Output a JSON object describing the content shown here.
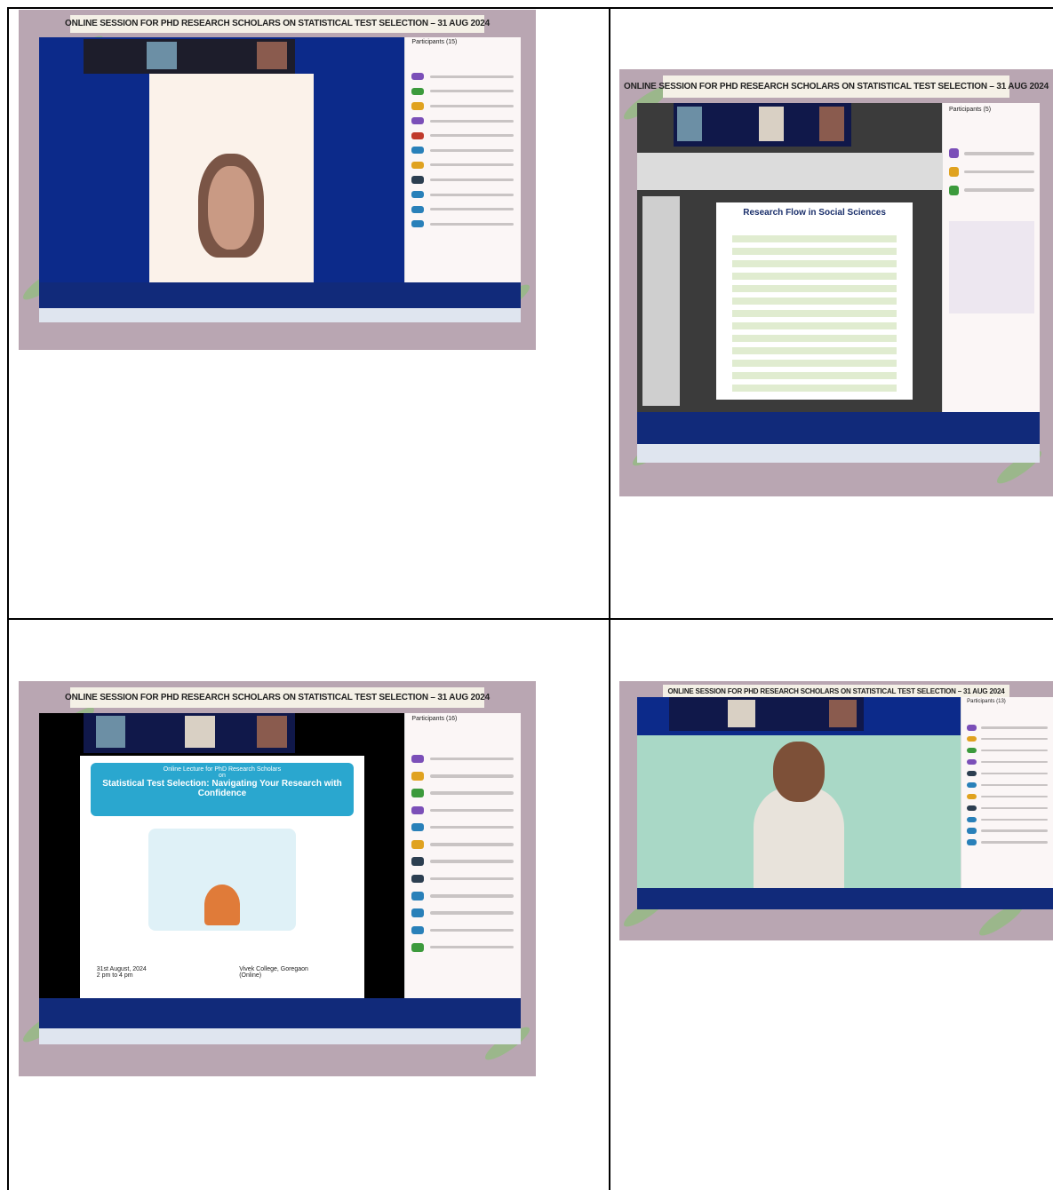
{
  "screenshots": [
    {
      "banner": "ONLINE SESSION FOR PHD RESEARCH SCHOLARS ON STATISTICAL TEST SELECTION – 31 AUG 2024",
      "panel_title": "Participants (15)",
      "view": "speaker-video"
    },
    {
      "banner": "ONLINE SESSION FOR PHD RESEARCH SCHOLARS ON STATISTICAL TEST SELECTION – 31 AUG 2024",
      "panel_title": "Participants (5)",
      "slide_title": "Research Flow in Social Sciences",
      "view": "shared-slides"
    },
    {
      "banner": "ONLINE SESSION FOR PHD RESEARCH SCHOLARS ON STATISTICAL TEST SELECTION – 31 AUG 2024",
      "panel_title": "Participants (16)",
      "slide_subtitle": "Online Lecture for PhD Research Scholars",
      "slide_on": "on",
      "slide_title": "Statistical Test Selection: Navigating Your Research with Confidence",
      "date_line1": "31st August, 2024",
      "date_line2": "2 pm to 4 pm",
      "venue_line1": "Vivek College, Goregaon",
      "venue_line2": "(Online)",
      "view": "shared-poster"
    },
    {
      "banner": "ONLINE SESSION FOR PHD RESEARCH SCHOLARS ON STATISTICAL TEST SELECTION – 31 AUG 2024",
      "panel_title": "Participants (13)",
      "view": "speaker-video"
    }
  ],
  "colors": {
    "zoom_blue": "#0b1f6e",
    "background_mauve": "#b9a6b2",
    "leaf_green": "#8fbf7b",
    "slide_cyan": "#2aa7cf"
  }
}
